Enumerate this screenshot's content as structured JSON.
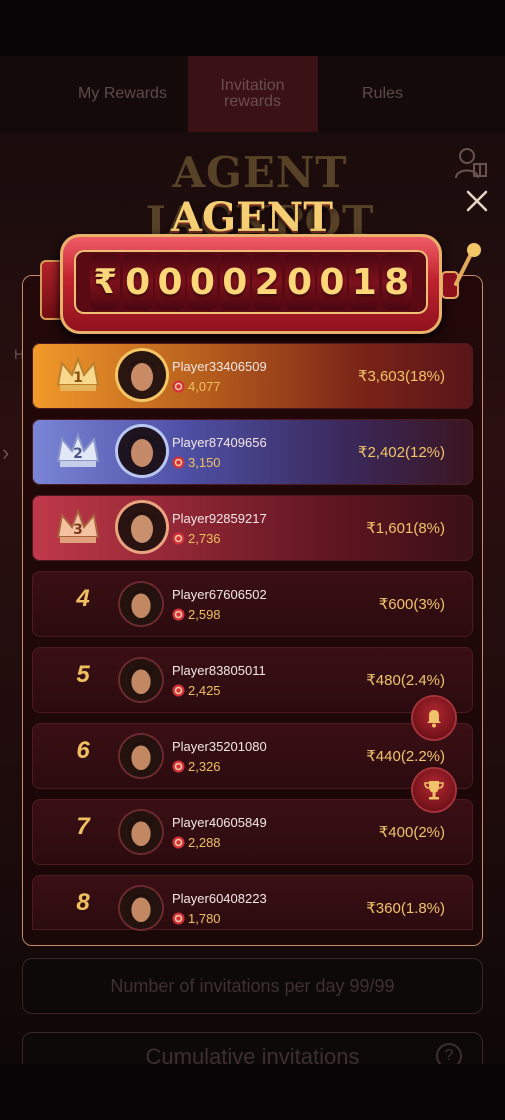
{
  "tabs": [
    {
      "label": "My Rewards"
    },
    {
      "label": "Invitation rewards"
    },
    {
      "label": "Rules"
    }
  ],
  "background": {
    "logo_text": "AGENT JACKPOT",
    "left_letter": "H",
    "invitations_per_day": "Number of invitations per day 99/99",
    "cumulative_invitations": "Cumulative invitations",
    "help_glyph": "?"
  },
  "jackpot": {
    "title": "AGENT JACKPOT",
    "currency": "₹",
    "digits": [
      "0",
      "0",
      "0",
      "0",
      "2",
      "0",
      "0",
      "1",
      "8"
    ]
  },
  "leaderboard": [
    {
      "rank": "1",
      "name": "Player33406509",
      "score": "4,077",
      "prize": "₹3,603(18%)",
      "tier": "gold"
    },
    {
      "rank": "2",
      "name": "Player87409656",
      "score": "3,150",
      "prize": "₹2,402(12%)",
      "tier": "silver"
    },
    {
      "rank": "3",
      "name": "Player92859217",
      "score": "2,736",
      "prize": "₹1,601(8%)",
      "tier": "bronze"
    },
    {
      "rank": "4",
      "name": "Player67606502",
      "score": "2,598",
      "prize": "₹600(3%)",
      "tier": "plain"
    },
    {
      "rank": "5",
      "name": "Player83805011",
      "score": "2,425",
      "prize": "₹480(2.4%)",
      "tier": "plain"
    },
    {
      "rank": "6",
      "name": "Player35201080",
      "score": "2,326",
      "prize": "₹440(2.2%)",
      "tier": "plain"
    },
    {
      "rank": "7",
      "name": "Player40605849",
      "score": "2,288",
      "prize": "₹400(2%)",
      "tier": "plain"
    },
    {
      "rank": "8",
      "name": "Player60408223",
      "score": "1,780",
      "prize": "₹360(1.8%)",
      "tier": "plain"
    }
  ],
  "icons": {
    "close": "close-icon",
    "user_gift": "user-gift-icon",
    "bell": "bell-icon",
    "trophy": "trophy-icon",
    "chip": "chip-icon"
  },
  "colors": {
    "accent_gold": "#f2c368",
    "panel_border": "#c78c6a",
    "row_bg": "#2b0b0f"
  }
}
